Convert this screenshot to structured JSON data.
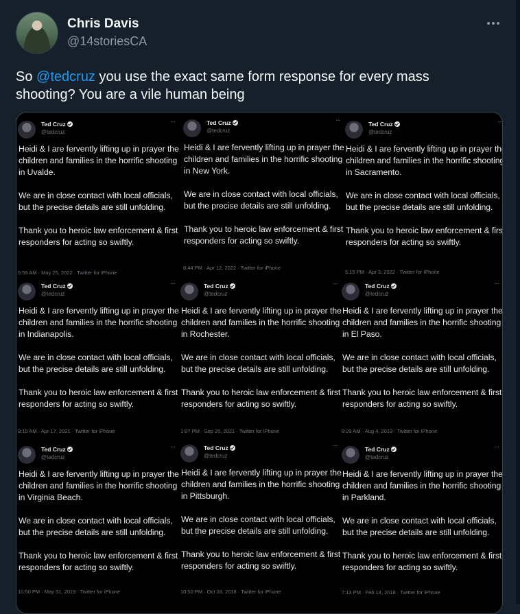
{
  "author": {
    "name": "Chris Davis",
    "handle": "@14storiesCA"
  },
  "tweet": {
    "prefix": "So ",
    "mention": "@tedcruz",
    "rest": " you use the exact same form response for every mass shooting? You are a vile human being"
  },
  "quoted_screens": {
    "name": "Ted Cruz",
    "handle": "@tedcruz",
    "more": "···",
    "line1": "Heidi & I are fervently lifting up in prayer the children and families in the",
    "line2": "We are in close contact with local officials, but the precise details are still unfolding.",
    "line3": "Thank you to heroic law enforcement & first responders for acting so swiftly.",
    "cards": [
      {
        "city": "horrific shooting in Uvalde.",
        "meta": "5:59 AM · May 25, 2022 · Twitter for iPhone"
      },
      {
        "city": "horrific shooting in New York.",
        "meta": "8:44 PM · Apr 12, 2022 · Twitter for iPhone"
      },
      {
        "city": "horrific shooting in Sacramento.",
        "meta": "5:15 PM · Apr 3, 2022 · Twitter for iPhone"
      },
      {
        "city": "horrific shooting in Indianapolis.",
        "meta": "9:10 AM · Apr 17, 2021 · Twitter for iPhone"
      },
      {
        "city": "horrific shooting in Rochester.",
        "meta": "1:07 PM · Sep 20, 2021 · Twitter for iPhone"
      },
      {
        "city": "horrific shooting in El Paso.",
        "meta": "8:29 AM · Aug 4, 2019 · Twitter for iPhone"
      },
      {
        "city": "horrific shooting in Virginia Beach.",
        "meta": "10:50 PM · May 31, 2019 · Twitter for iPhone"
      },
      {
        "city": "horrific shooting in Pittsburgh.",
        "meta": "10:50 PM · Oct 28, 2018 · Twitter for iPhone"
      },
      {
        "city": "horrific shooting in Parkland.",
        "meta": "7:13 PM · Feb 14, 2018 · Twitter for iPhone"
      }
    ]
  },
  "colors": {
    "background": "#15202b",
    "text": "#f7f9f9",
    "secondary": "#8b98a5",
    "accent": "#1d9bf0"
  },
  "icons": {
    "more": "more-horizontal-icon",
    "verified": "verified-badge-icon"
  }
}
